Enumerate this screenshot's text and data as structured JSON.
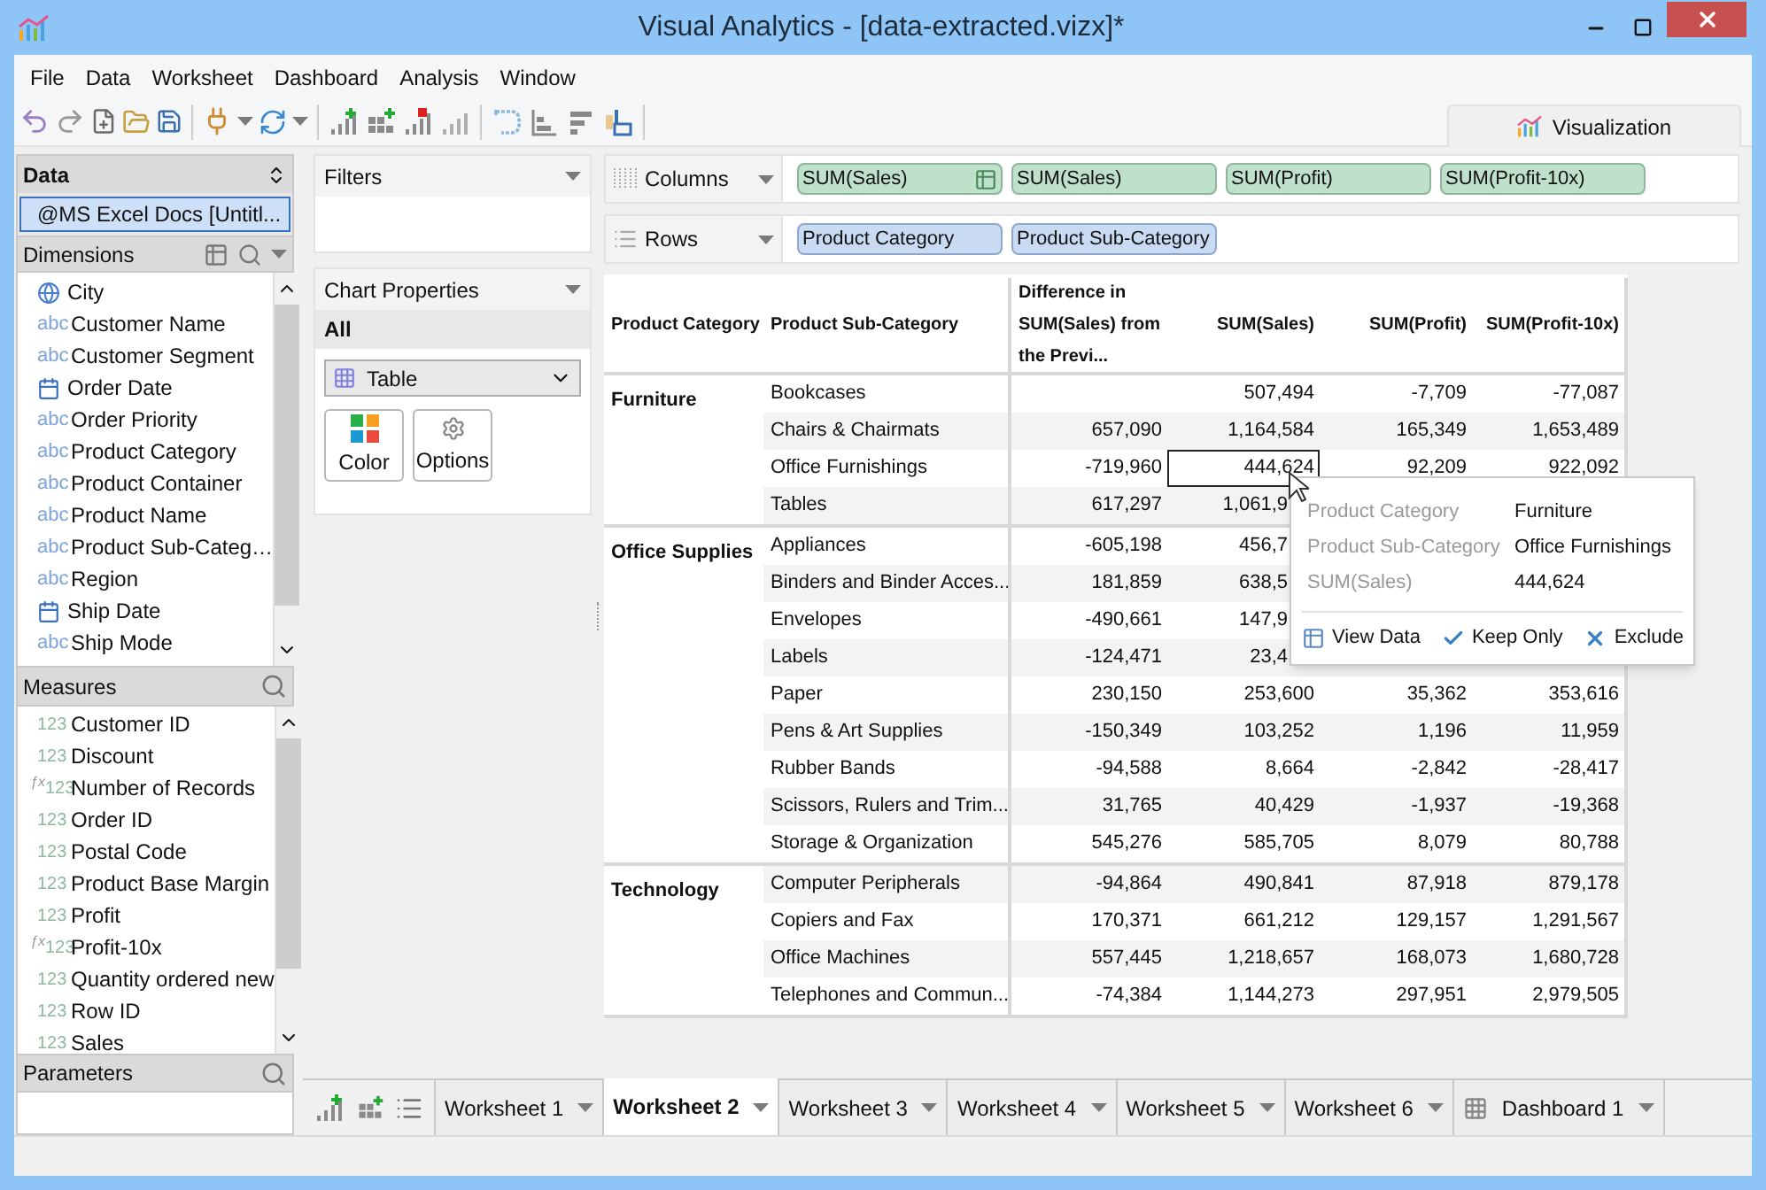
{
  "window": {
    "title": "Visual Analytics - [data-extracted.vizx]*"
  },
  "menu": [
    "File",
    "Data",
    "Worksheet",
    "Dashboard",
    "Analysis",
    "Window"
  ],
  "visualization_tab": {
    "label": "Visualization"
  },
  "data_panel": {
    "title": "Data",
    "source": {
      "label": "@MS Excel Docs [Untitl...",
      "selected": true
    }
  },
  "dimensions": {
    "title": "Dimensions",
    "items": [
      {
        "name": "City",
        "kind": "geo"
      },
      {
        "name": "Customer Name",
        "kind": "text",
        "badge": "abc"
      },
      {
        "name": "Customer Segment",
        "kind": "text",
        "badge": "abc"
      },
      {
        "name": "Order Date",
        "kind": "date"
      },
      {
        "name": "Order Priority",
        "kind": "text",
        "badge": "abc"
      },
      {
        "name": "Product Category",
        "kind": "text",
        "badge": "abc"
      },
      {
        "name": "Product Container",
        "kind": "text",
        "badge": "abc"
      },
      {
        "name": "Product Name",
        "kind": "text",
        "badge": "abc"
      },
      {
        "name": "Product Sub-Categ…",
        "kind": "text",
        "badge": "abc"
      },
      {
        "name": "Region",
        "kind": "text",
        "badge": "abc"
      },
      {
        "name": "Ship Date",
        "kind": "date"
      },
      {
        "name": "Ship Mode",
        "kind": "text",
        "badge": "abc"
      }
    ]
  },
  "measures": {
    "title": "Measures",
    "items": [
      {
        "name": "Customer ID",
        "kind": "number",
        "badge": "123"
      },
      {
        "name": "Discount",
        "kind": "number",
        "badge": "123"
      },
      {
        "name": "Number of Records",
        "kind": "calc",
        "prefix": "ƒx",
        "badge": "123"
      },
      {
        "name": "Order ID",
        "kind": "number",
        "badge": "123"
      },
      {
        "name": "Postal Code",
        "kind": "number",
        "badge": "123"
      },
      {
        "name": "Product Base Margin",
        "kind": "number",
        "badge": "123"
      },
      {
        "name": "Profit",
        "kind": "number",
        "badge": "123"
      },
      {
        "name": "Profit-10x",
        "kind": "calc",
        "prefix": "ƒx",
        "badge": "123"
      },
      {
        "name": "Quantity ordered new",
        "kind": "number",
        "badge": "123"
      },
      {
        "name": "Row ID",
        "kind": "number",
        "badge": "123"
      },
      {
        "name": "Sales",
        "kind": "number",
        "badge": "123"
      }
    ]
  },
  "parameters": {
    "title": "Parameters"
  },
  "filters": {
    "title": "Filters"
  },
  "chart_properties": {
    "title": "Chart Properties",
    "scope": "All",
    "chart_type": "Table",
    "buttons": [
      {
        "label": "Color",
        "kind": "color"
      },
      {
        "label": "Options",
        "kind": "options"
      }
    ]
  },
  "columns_shelf": {
    "label": "Columns",
    "pills": [
      {
        "label": "SUM(Sales)",
        "calc": true
      },
      {
        "label": "SUM(Sales)",
        "calc": false
      },
      {
        "label": "SUM(Profit)",
        "calc": false
      },
      {
        "label": "SUM(Profit-10x)",
        "calc": false
      }
    ]
  },
  "rows_shelf": {
    "label": "Rows",
    "pills": [
      {
        "label": "Product Category",
        "calc": false
      },
      {
        "label": "Product Sub-Category",
        "calc": false
      }
    ]
  },
  "table": {
    "columns": [
      "Product Category",
      "Product Sub-Category",
      "Difference in SUM(Sales) from the Previ...",
      "SUM(Sales)",
      "SUM(Profit)",
      "SUM(Profit-10x)"
    ],
    "groups": [
      {
        "category": "Furniture",
        "rows": [
          {
            "sub": "Bookcases",
            "sales": "507,494",
            "profit": "-7,709",
            "profit_10x": "-77,087",
            "selected": false
          },
          {
            "sub": "Chairs & Chairmats",
            "difference": "657,090",
            "sales": "1,164,584",
            "profit": "165,349",
            "profit_10x": "1,653,489",
            "selected": false
          },
          {
            "sub": "Office Furnishings",
            "difference": "-719,960",
            "sales": "444,624",
            "profit": "92,209",
            "profit_10x": "922,092",
            "selected": true
          },
          {
            "sub": "Tables",
            "difference": "617,297",
            "sales": "1,061,9",
            "selected": false
          }
        ]
      },
      {
        "category": "Office Supplies",
        "rows": [
          {
            "sub": "Appliances",
            "difference": "-605,198",
            "sales": "456,7",
            "selected": false
          },
          {
            "sub": "Binders and Binder Acces...",
            "difference": "181,859",
            "sales": "638,5",
            "selected": false
          },
          {
            "sub": "Envelopes",
            "difference": "-490,661",
            "sales": "147,9",
            "selected": false
          },
          {
            "sub": "Labels",
            "difference": "-124,471",
            "sales": "23,4",
            "selected": false
          },
          {
            "sub": "Paper",
            "difference": "230,150",
            "sales": "253,600",
            "profit": "35,362",
            "profit_10x": "353,616",
            "selected": false
          },
          {
            "sub": "Pens & Art Supplies",
            "difference": "-150,349",
            "sales": "103,252",
            "profit": "1,196",
            "profit_10x": "11,959",
            "selected": false
          },
          {
            "sub": "Rubber Bands",
            "difference": "-94,588",
            "sales": "8,664",
            "profit": "-2,842",
            "profit_10x": "-28,417",
            "selected": false
          },
          {
            "sub": "Scissors, Rulers and Trim...",
            "difference": "31,765",
            "sales": "40,429",
            "profit": "-1,937",
            "profit_10x": "-19,368",
            "selected": false
          },
          {
            "sub": "Storage & Organization",
            "difference": "545,276",
            "sales": "585,705",
            "profit": "8,079",
            "profit_10x": "80,788",
            "selected": false
          }
        ]
      },
      {
        "category": "Technology",
        "rows": [
          {
            "sub": "Computer Peripherals",
            "difference": "-94,864",
            "sales": "490,841",
            "profit": "87,918",
            "profit_10x": "879,178",
            "selected": false
          },
          {
            "sub": "Copiers and Fax",
            "difference": "170,371",
            "sales": "661,212",
            "profit": "129,157",
            "profit_10x": "1,291,567",
            "selected": false
          },
          {
            "sub": "Office Machines",
            "difference": "557,445",
            "sales": "1,218,657",
            "profit": "168,073",
            "profit_10x": "1,680,728",
            "selected": false
          },
          {
            "sub": "Telephones and Commun...",
            "difference": "-74,384",
            "sales": "1,144,273",
            "profit": "297,951",
            "profit_10x": "2,979,505",
            "selected": false
          }
        ]
      }
    ]
  },
  "tooltip": {
    "fields": [
      {
        "label": "Product Category",
        "value": "Furniture"
      },
      {
        "label": "Product Sub-Category",
        "value": "Office Furnishings"
      },
      {
        "label": "SUM(Sales)",
        "value": "444,624"
      }
    ],
    "actions": [
      {
        "label": "View Data",
        "kind": "view"
      },
      {
        "label": "Keep Only",
        "kind": "keep"
      },
      {
        "label": "Exclude",
        "kind": "exclude"
      }
    ]
  },
  "sheet_tabs": [
    {
      "label": "Worksheet 1",
      "kind": "worksheet",
      "selected": false
    },
    {
      "label": "Worksheet 2",
      "kind": "worksheet",
      "selected": true
    },
    {
      "label": "Worksheet 3",
      "kind": "worksheet",
      "selected": false
    },
    {
      "label": "Worksheet 4",
      "kind": "worksheet",
      "selected": false
    },
    {
      "label": "Worksheet 5",
      "kind": "worksheet",
      "selected": false
    },
    {
      "label": "Worksheet 6",
      "kind": "worksheet",
      "selected": false
    },
    {
      "label": "Dashboard 1",
      "kind": "dashboard",
      "selected": false
    }
  ]
}
